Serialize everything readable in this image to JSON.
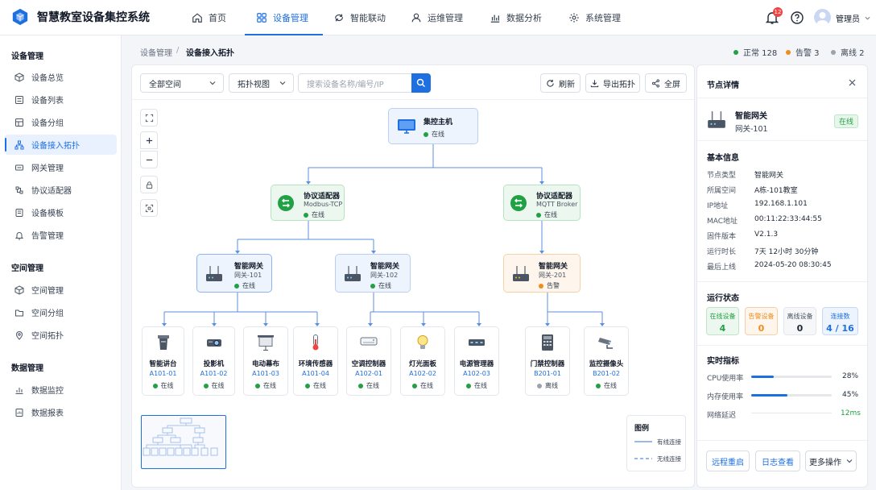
{
  "app": {
    "title": "智慧教室设备集控系统"
  },
  "topnav": [
    {
      "label": "首页",
      "icon": "home-icon"
    },
    {
      "label": "设备管理",
      "icon": "grid-icon",
      "active": true
    },
    {
      "label": "智能联动",
      "icon": "link-icon"
    },
    {
      "label": "运维管理",
      "icon": "user-icon"
    },
    {
      "label": "数据分析",
      "icon": "chart-icon"
    },
    {
      "label": "系统管理",
      "icon": "gear-icon"
    }
  ],
  "header": {
    "notifications": "12",
    "user": "管理员"
  },
  "sidebar": {
    "device_section": "设备管理",
    "device_items": [
      "设备总览",
      "设备列表",
      "设备分组",
      "设备接入拓扑",
      "网关管理",
      "协议适配器",
      "设备模板",
      "告警管理"
    ],
    "space_section": "空间管理",
    "space_items": [
      "空间管理",
      "空间分组",
      "空间拓扑"
    ],
    "data_section": "数据管理",
    "data_items": [
      "数据监控",
      "数据报表"
    ]
  },
  "breadcrumb": {
    "parent": "设备管理",
    "sep": "/",
    "current": "设备接入拓扑"
  },
  "status": {
    "normal": "正常 128",
    "alarm": "告警 3",
    "offline": "离线 2"
  },
  "toolbar": {
    "space_select": "全部空间",
    "view_select": "拓扑视图",
    "search_placeholder": "搜索设备名称/编号/IP",
    "refresh": "刷新",
    "export": "导出拓扑",
    "fullscreen": "全屏"
  },
  "topology": {
    "host": {
      "name": "集控主机",
      "status": "在线"
    },
    "adapters": [
      {
        "name": "协议适配器",
        "protocol": "Modbus-TCP",
        "status": "在线"
      },
      {
        "name": "协议适配器",
        "protocol": "MQTT Broker",
        "status": "在线"
      }
    ],
    "gateways": [
      {
        "name": "智能网关",
        "id": "网关-101",
        "status": "在线"
      },
      {
        "name": "智能网关",
        "id": "网关-102",
        "status": "在线"
      },
      {
        "name": "智能网关",
        "id": "网关-201",
        "status": "告警"
      }
    ],
    "devices": [
      {
        "name": "智能讲台",
        "id": "A101-01",
        "status": "在线"
      },
      {
        "name": "投影机",
        "id": "A101-02",
        "status": "在线"
      },
      {
        "name": "电动幕布",
        "id": "A101-03",
        "status": "在线"
      },
      {
        "name": "环境传感器",
        "id": "A101-04",
        "status": "在线"
      },
      {
        "name": "空调控制器",
        "id": "A102-01",
        "status": "在线"
      },
      {
        "name": "灯光面板",
        "id": "A102-02",
        "status": "在线"
      },
      {
        "name": "电源管理器",
        "id": "A102-03",
        "status": "在线"
      },
      {
        "name": "门禁控制器",
        "id": "B201-01",
        "status": "离线"
      },
      {
        "name": "监控摄像头",
        "id": "B201-02",
        "status": "在线"
      }
    ]
  },
  "legend": {
    "title": "图例",
    "wired": "有线连接",
    "wireless": "无线连接"
  },
  "panel": {
    "title": "节点详情",
    "node_name": "智能网关",
    "node_id": "网关-101",
    "node_status": "在线",
    "basic_title": "基本信息",
    "basic": [
      {
        "k": "节点类型",
        "v": "智能网关"
      },
      {
        "k": "所属空间",
        "v": "A栋-101教室"
      },
      {
        "k": "IP地址",
        "v": "192.168.1.101"
      },
      {
        "k": "MAC地址",
        "v": "00:11:22:33:44:55"
      },
      {
        "k": "固件版本",
        "v": "V2.1.3"
      },
      {
        "k": "运行时长",
        "v": "7天 12小时 30分钟"
      },
      {
        "k": "最后上线",
        "v": "2024-05-20 08:30:45"
      }
    ],
    "run_title": "运行状态",
    "cards": [
      {
        "label": "在线设备",
        "value": "4"
      },
      {
        "label": "告警设备",
        "value": "0"
      },
      {
        "label": "离线设备",
        "value": "0"
      },
      {
        "label": "连接数",
        "value": "4 / 16"
      }
    ],
    "metrics_title": "实时指标",
    "cpu_label": "CPU使用率",
    "cpu_value": "28%",
    "cpu_level": 28,
    "mem_label": "内存使用率",
    "mem_value": "45%",
    "mem_level": 45,
    "lat_label": "网络延迟",
    "lat_value": "12ms",
    "actions": [
      "远程重启",
      "日志查看",
      "更多操作"
    ]
  },
  "colors": {
    "accent": "#1e6fe0",
    "online": "#22a045",
    "alarm": "#f08c1e",
    "offline": "#9aa3af"
  }
}
